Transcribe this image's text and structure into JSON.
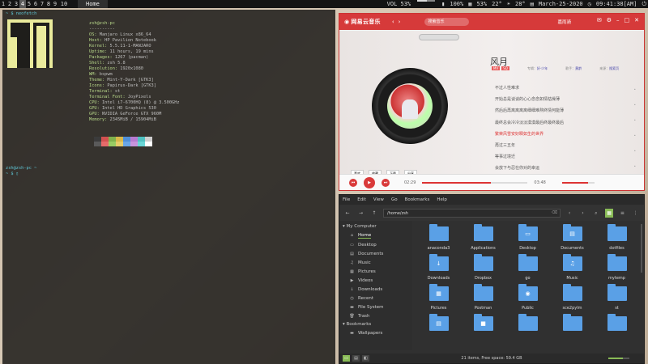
{
  "topbar": {
    "workspaces": [
      "1",
      "2",
      "3",
      "4",
      "5",
      "6",
      "7",
      "8",
      "9",
      "10"
    ],
    "active_workspace_index": 3,
    "active_window": "Home",
    "volume_label": "VOL 53%",
    "volume_fraction": 0.53,
    "battery": "100%",
    "cpu": "53%",
    "cpu_temp": "22°",
    "weather": "28°",
    "date": "March-25-2020",
    "time": "09:41:38[AM]"
  },
  "terminal": {
    "prompt1": "~ $ neofetch",
    "user_host": "zsh@zsh-pc",
    "separator": "----------",
    "info": [
      {
        "key": "OS:",
        "val": " Manjaro Linux x86_64"
      },
      {
        "key": "Host:",
        "val": " HP Pavilion Notebook"
      },
      {
        "key": "Kernel:",
        "val": " 5.5.11-1-MANJARO"
      },
      {
        "key": "Uptime:",
        "val": " 11 hours, 19 mins"
      },
      {
        "key": "Packages:",
        "val": " 1267 (pacman)"
      },
      {
        "key": "Shell:",
        "val": " zsh 5.8"
      },
      {
        "key": "Resolution:",
        "val": " 1920x1080"
      },
      {
        "key": "WM:",
        "val": " bspwm"
      },
      {
        "key": "Theme:",
        "val": " Mint-Y-Dark [GTK3]"
      },
      {
        "key": "Icons:",
        "val": " Papirus-Dark [GTK3]"
      },
      {
        "key": "Terminal:",
        "val": " st"
      },
      {
        "key": "Terminal Font:",
        "val": " JoyPixels"
      },
      {
        "key": "CPU:",
        "val": " Intel i7-6700HQ (8) @ 3.500GHz"
      },
      {
        "key": "GPU:",
        "val": " Intel HD Graphics 530"
      },
      {
        "key": "GPU:",
        "val": " NVIDIA GeForce GTX 960M"
      },
      {
        "key": "Memory:",
        "val": " 2345MiB / 15904MiB"
      }
    ],
    "palette": [
      "#3b3b3b",
      "#d25050",
      "#7fb24c",
      "#d9b84a",
      "#4f8fd9",
      "#b77ad1",
      "#4fc1c1",
      "#cfcfcf",
      "#5a5a5a",
      "#e56a6a",
      "#98cc63",
      "#e6cc6a",
      "#6aa6e6",
      "#c894dd",
      "#6ad6d6",
      "#ffffff"
    ],
    "prompt2_user": "zsh@zsh-pc ~",
    "prompt2": "~ $ ▯"
  },
  "music": {
    "app_name": "网易云音乐",
    "search_placeholder": "搜索音乐",
    "username": "嘉雨骑",
    "song_title": "风月",
    "tags": [
      "MV",
      "SQ"
    ],
    "album_label": "专辑：",
    "album": "好·少年",
    "artist_label": "歌手：",
    "artist": "黄龄",
    "source_label": "来源：",
    "source": "搜索页",
    "lyrics": [
      "不过人性难求",
      "开始总是谈谈的心心念念如情枯燥薄",
      "然后后再离离离离细细难熬终情何能薄",
      "最终总会冷冷淡淡漠漠最后终最终最后",
      "繁荣风雪安好瞬如生的世界",
      "再过三五年",
      "等事过境迁",
      "会放下与忍在你对的幸运",
      "以后终未平"
    ],
    "current_lyric_index": 4,
    "actions": [
      "喜欢",
      "收藏",
      "下载",
      "分享"
    ],
    "time_current": "02:29",
    "time_total": "03:48",
    "progress_fraction": 0.65,
    "volume_fraction": 0.8,
    "scroll_markers": [
      "•",
      "•",
      "•",
      "•",
      "•",
      "•",
      "•",
      "•",
      "•"
    ]
  },
  "files": {
    "menu": [
      "File",
      "Edit",
      "View",
      "Go",
      "Bookmarks",
      "Help"
    ],
    "path": "/home/zsh",
    "sidebar": {
      "my_computer": "My Computer",
      "items": [
        {
          "label": "Home",
          "icon": "home-icon",
          "glyph": "⌂"
        },
        {
          "label": "Desktop",
          "icon": "desktop-icon",
          "glyph": "▭"
        },
        {
          "label": "Documents",
          "icon": "documents-icon",
          "glyph": "▤"
        },
        {
          "label": "Music",
          "icon": "music-icon",
          "glyph": "♫"
        },
        {
          "label": "Pictures",
          "icon": "pictures-icon",
          "glyph": "▦"
        },
        {
          "label": "Videos",
          "icon": "videos-icon",
          "glyph": "▶"
        },
        {
          "label": "Downloads",
          "icon": "downloads-icon",
          "glyph": "↓"
        },
        {
          "label": "Recent",
          "icon": "recent-icon",
          "glyph": "◷"
        },
        {
          "label": "File System",
          "icon": "drive-icon",
          "glyph": "▬"
        },
        {
          "label": "Trash",
          "icon": "trash-icon",
          "glyph": "🗑"
        }
      ],
      "bookmarks": "Bookmarks",
      "bookmark_items": [
        {
          "label": "Wallpapers",
          "icon": "folder-icon",
          "glyph": "▬"
        }
      ]
    },
    "items": [
      {
        "name": "anaconda3",
        "glyph": ""
      },
      {
        "name": "Applications",
        "glyph": ""
      },
      {
        "name": "Desktop",
        "glyph": "▭"
      },
      {
        "name": "Documents",
        "glyph": "▤"
      },
      {
        "name": "dotfiles",
        "glyph": ""
      },
      {
        "name": "Downloads",
        "glyph": "↓"
      },
      {
        "name": "Dropbox",
        "glyph": ""
      },
      {
        "name": "go",
        "glyph": ""
      },
      {
        "name": "Music",
        "glyph": "♫"
      },
      {
        "name": "mytemp",
        "glyph": ""
      },
      {
        "name": "Pictures",
        "glyph": "▦"
      },
      {
        "name": "Postman",
        "glyph": ""
      },
      {
        "name": "Public",
        "glyph": "◉"
      },
      {
        "name": "sce2pylm",
        "glyph": ""
      },
      {
        "name": "st",
        "glyph": ""
      },
      {
        "name": "",
        "glyph": "▤"
      },
      {
        "name": "",
        "glyph": "■"
      },
      {
        "name": "",
        "glyph": ""
      },
      {
        "name": "",
        "glyph": ""
      },
      {
        "name": "",
        "glyph": ""
      }
    ],
    "status": "21 items, Free space: 59.4 GB",
    "zoom_fraction": 0.7
  }
}
